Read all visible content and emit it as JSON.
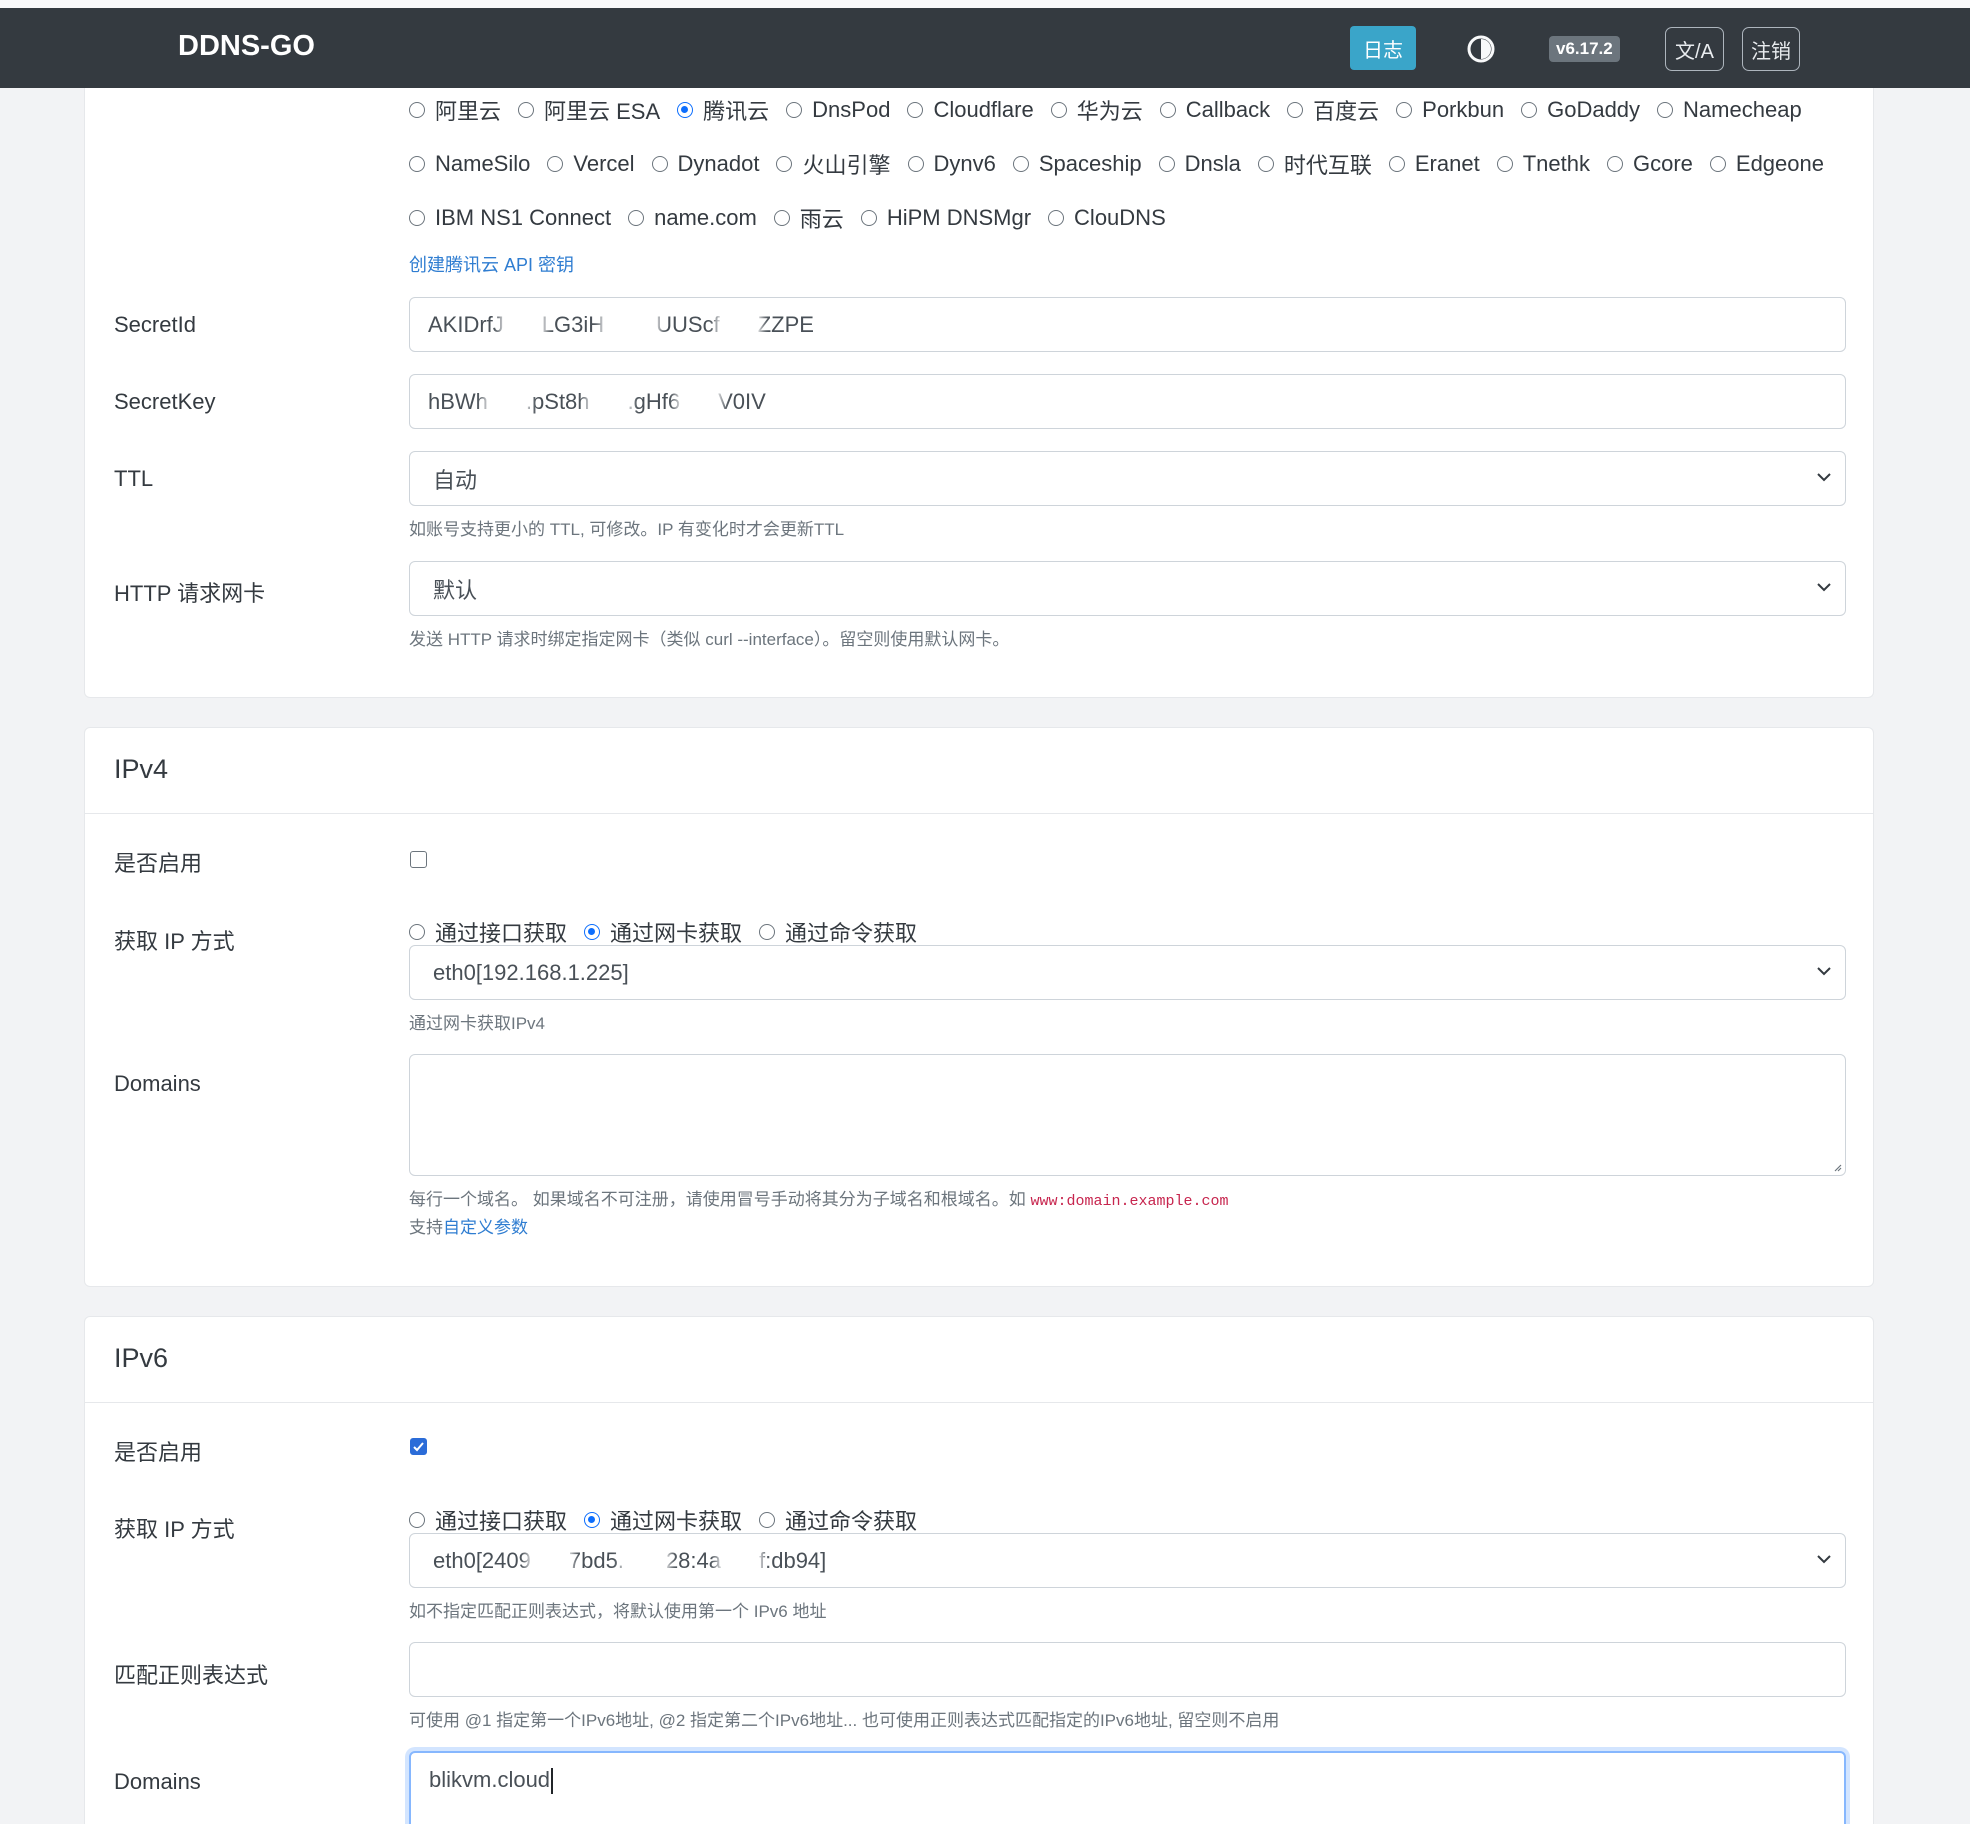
{
  "navbar": {
    "brand": "DDNS-GO",
    "log_button": "日志",
    "theme_icon": "half-circle-icon",
    "version": "v6.17.2",
    "lang_button": "文/A",
    "logout_button": "注销"
  },
  "dns": {
    "providers_row1": [
      "阿里云",
      "阿里云 ESA",
      "腾讯云",
      "DnsPod",
      "Cloudflare",
      "华为云",
      "Callback",
      "百度云",
      "Porkbun",
      "GoDaddy",
      "Namecheap"
    ],
    "providers_row2": [
      "NameSilo",
      "Vercel",
      "Dynadot",
      "火山引擎",
      "Dynv6",
      "Spaceship",
      "Dnsla",
      "时代互联",
      "Eranet",
      "Tnethk",
      "Gcore",
      "Edgeone"
    ],
    "providers_row3": [
      "IBM NS1 Connect",
      "name.com",
      "雨云",
      "HiPM DNSMgr",
      "ClouDNS"
    ],
    "selected_provider": "腾讯云",
    "create_key_link": "创建腾讯云 API 密钥",
    "secret_id_label": "SecretId",
    "secret_id_parts": [
      "AKIDrfJ",
      "LG3iH",
      "UUScf",
      "ZZPE"
    ],
    "secret_key_label": "SecretKey",
    "secret_key_parts": [
      "hBWh",
      ".pSt8h",
      ".gHf6",
      "V0IV"
    ],
    "ttl_label": "TTL",
    "ttl_value": "自动",
    "ttl_help": "如账号支持更小的 TTL, 可修改。IP 有变化时才会更新TTL",
    "http_nic_label": "HTTP 请求网卡",
    "http_nic_value": "默认",
    "http_nic_help": "发送 HTTP 请求时绑定指定网卡（类似 curl --interface）。留空则使用默认网卡。"
  },
  "ipv4": {
    "title": "IPv4",
    "enable_label": "是否启用",
    "enabled": false,
    "method_label": "获取 IP 方式",
    "methods": [
      "通过接口获取",
      "通过网卡获取",
      "通过命令获取"
    ],
    "selected_method": "通过网卡获取",
    "nic_value": "eth0[192.168.1.225]",
    "nic_help": "通过网卡获取IPv4",
    "domains_label": "Domains",
    "domains_value": "",
    "domains_help": "每行一个域名。 如果域名不可注册，请使用冒号手动将其分为子域名和根域名。如",
    "domains_help_code": "www:domain.example.com",
    "custom_params_prefix": "支持",
    "custom_params_link": "自定义参数"
  },
  "ipv6": {
    "title": "IPv6",
    "enable_label": "是否启用",
    "enabled": true,
    "method_label": "获取 IP 方式",
    "methods": [
      "通过接口获取",
      "通过网卡获取",
      "通过命令获取"
    ],
    "selected_method": "通过网卡获取",
    "nic_value_parts": [
      "eth0[2409",
      "7bd5.",
      "28:4a",
      "f:db94]"
    ],
    "nic_help": "如不指定匹配正则表达式，将默认使用第一个 IPv6 地址",
    "regex_label": "匹配正则表达式",
    "regex_value": "",
    "regex_help": "可使用 @1 指定第一个IPv6地址, @2 指定第二个IPv6地址... 也可使用正则表达式匹配指定的IPv6地址, 留空则不启用",
    "domains_label": "Domains",
    "domains_value": "blikvm.cloud"
  },
  "colors": {
    "navbar_bg": "#343a40",
    "log_button_bg": "#3aa5c9",
    "link": "#2f7dd1",
    "checked": "#2b6cd8"
  }
}
